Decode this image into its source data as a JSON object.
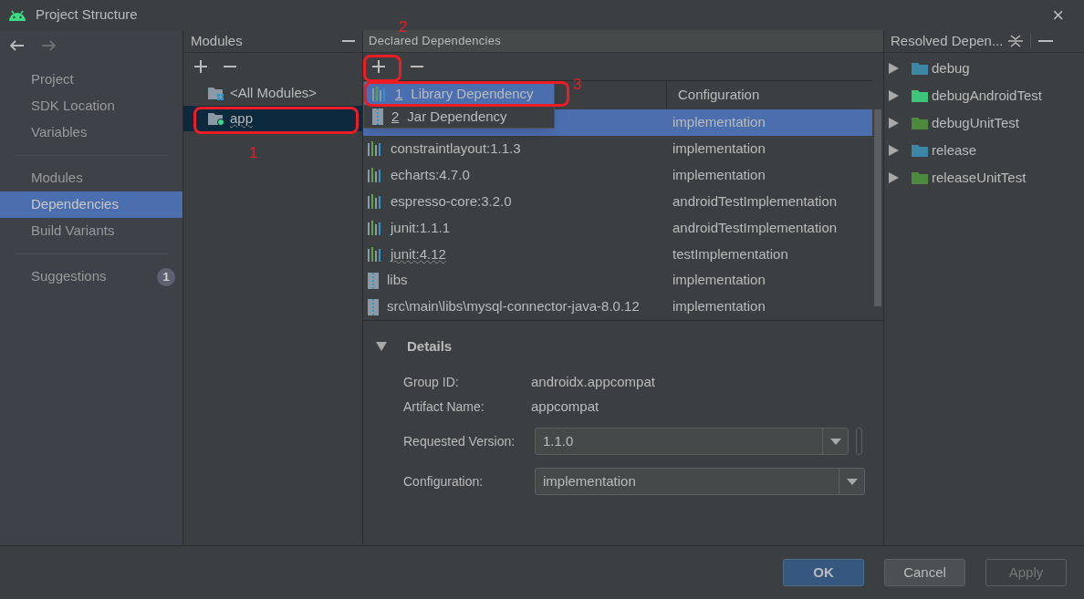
{
  "window": {
    "title": "Project Structure",
    "close": "×"
  },
  "sidebar": {
    "back_enabled": true,
    "forward_enabled": false,
    "groups": [
      [
        {
          "label": "Project",
          "selected": false
        },
        {
          "label": "SDK Location",
          "selected": false
        },
        {
          "label": "Variables",
          "selected": false
        }
      ],
      [
        {
          "label": "Modules",
          "selected": false
        },
        {
          "label": "Dependencies",
          "selected": true
        },
        {
          "label": "Build Variants",
          "selected": false
        }
      ],
      [
        {
          "label": "Suggestions",
          "selected": false,
          "badge": "1"
        }
      ]
    ]
  },
  "modules": {
    "title": "Modules",
    "items": [
      {
        "label": "<All Modules>",
        "kind": "all",
        "selected": false,
        "underlined": false
      },
      {
        "label": "app",
        "kind": "module",
        "selected": true,
        "underlined": true
      }
    ]
  },
  "declared": {
    "title": "Declared Dependencies",
    "columns": [
      "Configuration"
    ],
    "menu": [
      {
        "number": "1",
        "label": "Library Dependency",
        "kind": "library",
        "selected": true
      },
      {
        "number": "2",
        "label": "Jar Dependency",
        "kind": "jar",
        "selected": false
      }
    ],
    "rows": [
      {
        "configuration": "implementation",
        "selected": true
      },
      {
        "kind": "library",
        "name": "constraintlayout:1.1.3",
        "configuration": "implementation",
        "selected": false,
        "underlined": false
      },
      {
        "kind": "library",
        "name": "echarts:4.7.0",
        "configuration": "implementation",
        "selected": false,
        "underlined": false
      },
      {
        "kind": "library",
        "name": "espresso-core:3.2.0",
        "configuration": "androidTestImplementation",
        "selected": false,
        "underlined": false
      },
      {
        "kind": "library",
        "name": "junit:1.1.1",
        "configuration": "androidTestImplementation",
        "selected": false,
        "underlined": false
      },
      {
        "kind": "library",
        "name": "junit:4.12",
        "configuration": "testImplementation",
        "selected": false,
        "underlined": true
      },
      {
        "kind": "jar",
        "name": "libs",
        "configuration": "implementation",
        "selected": false,
        "underlined": false
      },
      {
        "kind": "jar",
        "name": "src\\main\\libs\\mysql-connector-java-8.0.12",
        "configuration": "implementation",
        "selected": false,
        "underlined": false
      }
    ]
  },
  "details": {
    "title": "Details",
    "expanded": true,
    "group_id_label": "Group ID:",
    "group_id": "androidx.appcompat",
    "artifact_label": "Artifact Name:",
    "artifact": "appcompat",
    "version_label": "Requested Version:",
    "version": "1.1.0",
    "configuration_label": "Configuration:",
    "configuration": "implementation"
  },
  "resolved": {
    "title": "Resolved Depen...",
    "items": [
      {
        "label": "debug",
        "color": "#3b87a5",
        "expanded": false
      },
      {
        "label": "debugAndroidTest",
        "color": "#3dc57a",
        "expanded": false
      },
      {
        "label": "debugUnitTest",
        "color": "#4e8a3e",
        "expanded": false
      },
      {
        "label": "release",
        "color": "#3b87a5",
        "expanded": false
      },
      {
        "label": "releaseUnitTest",
        "color": "#4e8a3e",
        "expanded": false
      }
    ]
  },
  "buttons": [
    {
      "label": "OK",
      "kind": "default",
      "disabled": false
    },
    {
      "label": "Cancel",
      "kind": "normal",
      "disabled": false
    },
    {
      "label": "Apply",
      "kind": "normal",
      "disabled": true
    }
  ],
  "annotations": [
    {
      "label": "1"
    },
    {
      "label": "2"
    },
    {
      "label": "3"
    }
  ]
}
